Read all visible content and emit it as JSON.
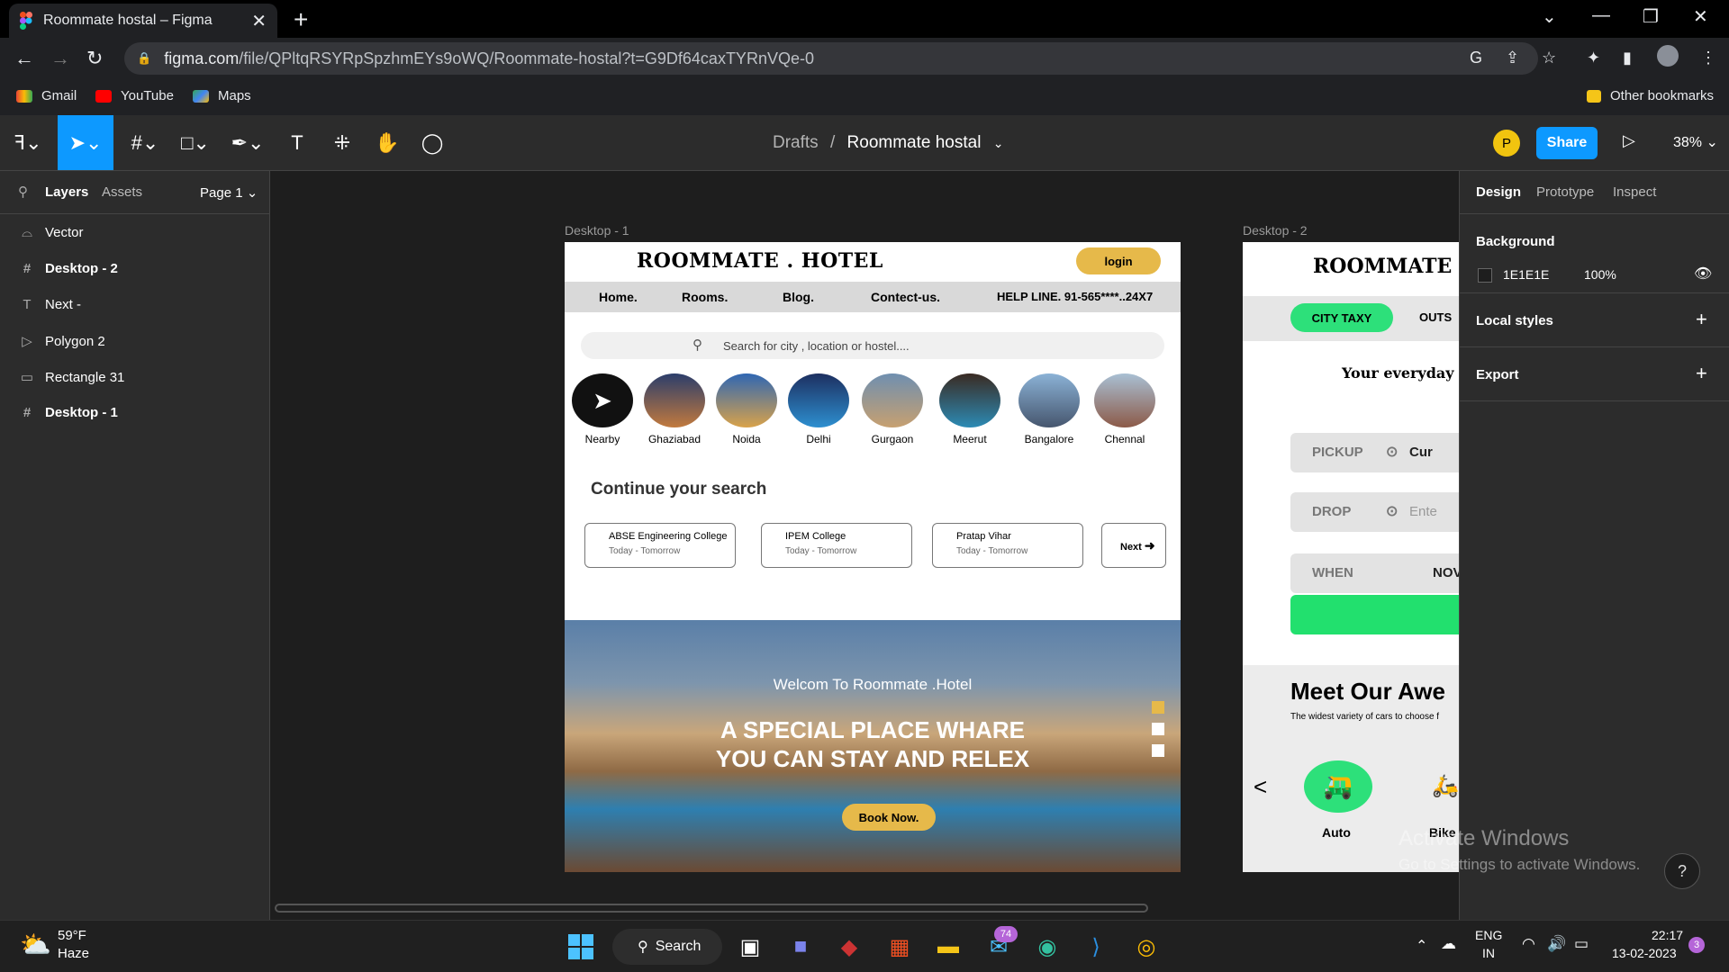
{
  "browser": {
    "tab_title": "Roommate hostal – Figma",
    "new_tab": "+",
    "url_host": "figma.com",
    "url_path": "/file/QPltqRSYRpSpzhmEYs9oWQ/Roommate-hostal?t=G9Df64caxTYRnVQe-0",
    "bookmarks": [
      "Gmail",
      "YouTube",
      "Maps"
    ],
    "other_bookmarks": "Other bookmarks"
  },
  "figma": {
    "crumb_drafts": "Drafts",
    "crumb_sep": "/",
    "file_name": "Roommate hostal",
    "avatar_initial": "P",
    "share": "Share",
    "zoom": "38%",
    "left_tabs": {
      "layers": "Layers",
      "assets": "Assets",
      "page": "Page 1"
    },
    "layers": [
      "Vector",
      "Desktop - 2",
      "Next -",
      "Polygon 2",
      "Rectangle 31",
      "Desktop - 1"
    ],
    "right_tabs": {
      "design": "Design",
      "prototype": "Prototype",
      "inspect": "Inspect"
    },
    "background_label": "Background",
    "background_hex": "1E1E1E",
    "background_opacity": "100%",
    "local_styles": "Local styles",
    "export": "Export",
    "colors": {
      "accent": "#0d99ff",
      "panel": "#2c2c2c",
      "canvas": "#1e1e1e"
    }
  },
  "frame1": {
    "label": "Desktop - 1",
    "logo": "ROOMMATE . HOTEL",
    "login": "login",
    "nav": [
      "Home.",
      "Rooms.",
      "Blog.",
      "Contect-us."
    ],
    "helpline": "HELP LINE. 91-565****..24X7",
    "search_placeholder": "Search for city , location  or  hostel....",
    "cities": [
      "Nearby",
      "Ghaziabad",
      "Noida",
      "Delhi",
      "Gurgaon",
      "Meerut",
      "Bangalore",
      "Chennal"
    ],
    "continue": "Continue your search",
    "cards": [
      {
        "title": "ABSE Engineering College",
        "sub": "Today - Tomorrow"
      },
      {
        "title": "IPEM College",
        "sub": "Today - Tomorrow"
      },
      {
        "title": "Pratap Vihar",
        "sub": "Today - Tomorrow"
      }
    ],
    "next": "Next",
    "hero_welcome": "Welcom To Roommate .Hotel",
    "hero_line1": "A SPECIAL PLACE WHARE",
    "hero_line2": "YOU CAN STAY AND RELEX",
    "book": "Book Now.",
    "accent": "#e6b94a"
  },
  "frame2": {
    "label": "Desktop - 2",
    "logo": "ROOMMATE . CA",
    "city_taxy": "CITY TAXY",
    "outs": "OUTS",
    "everyday": "Your everyday",
    "pickup": "PICKUP",
    "pickup_val": "Cur",
    "drop": "DROP",
    "drop_val": "Ente",
    "when": "WHEN",
    "when_val": "NOV",
    "meet": "Meet Our Awe",
    "meet_sub": "The widest variety of cars to choose f",
    "auto": "Auto",
    "bike": "Bike",
    "prev": "<"
  },
  "watermark": {
    "line1": "Activate Windows",
    "line2": "Go to Settings to activate Windows."
  },
  "help": "?",
  "taskbar": {
    "weather_temp": "59°F",
    "weather_desc": "Haze",
    "search": "Search",
    "mail_badge": "74",
    "lang1": "ENG",
    "lang2": "IN",
    "time": "22:17",
    "date": "13-02-2023",
    "notif": "3"
  }
}
